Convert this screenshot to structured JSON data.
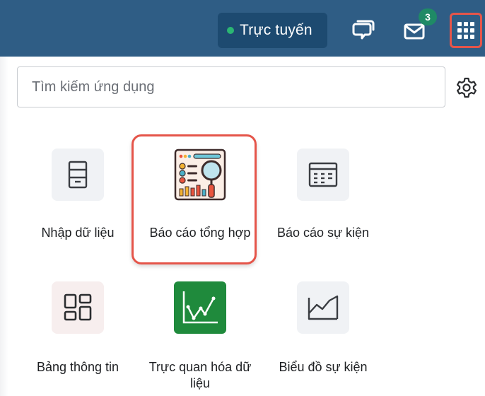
{
  "topbar": {
    "status_label": "Trực tuyến",
    "mail_badge": "3",
    "colors": {
      "bar": "#2f5d85",
      "pill": "#1d4a70",
      "online": "#2bb673",
      "badge": "#1f8a66",
      "highlight": "#e5554a"
    },
    "icons": [
      "chat-icon",
      "mail-icon",
      "apps-grid-icon"
    ]
  },
  "search": {
    "placeholder": "Tìm kiếm ứng dụng",
    "settings_icon": "gear-icon"
  },
  "apps": [
    {
      "label": "Nhập dữ liệu",
      "icon": "form-icon"
    },
    {
      "label": "Báo cáo tổng hợp",
      "icon": "report-search-icon",
      "highlighted": true
    },
    {
      "label": "Báo cáo sự kiện",
      "icon": "table-icon"
    },
    {
      "label": "Bảng thông tin",
      "icon": "dashboard-icon"
    },
    {
      "label": "Trực quan hóa dữ liệu",
      "icon": "line-chart-icon"
    },
    {
      "label": "Biểu đồ sự kiện",
      "icon": "area-chart-icon"
    }
  ]
}
